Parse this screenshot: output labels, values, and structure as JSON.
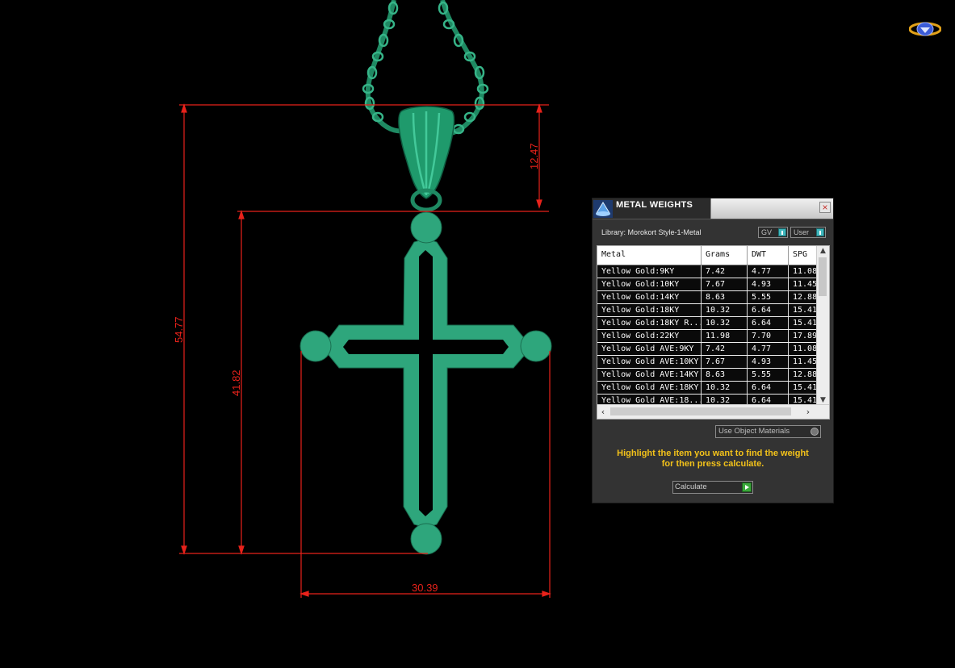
{
  "viewport": {
    "dimensions": {
      "overall_height": "54.77",
      "body_height": "41.82",
      "bail_height": "12.47",
      "width": "30.39"
    },
    "colors": {
      "model": "#2ea67c",
      "dimension_lines": "#e8221b",
      "background": "#000000"
    }
  },
  "panel": {
    "title": "METAL WEIGHTS",
    "close_label": "×",
    "library_label": "Library: Morokort Style-1-Metal",
    "gv_toggle": "GV",
    "user_toggle": "User",
    "columns": [
      "Metal",
      "Grams",
      "DWT",
      "SPG"
    ],
    "rows": [
      [
        "Yellow Gold:9KY",
        "7.42",
        "4.77",
        "11.08"
      ],
      [
        "Yellow Gold:10KY",
        "7.67",
        "4.93",
        "11.45"
      ],
      [
        "Yellow Gold:14KY",
        "8.63",
        "5.55",
        "12.88"
      ],
      [
        "Yellow Gold:18KY",
        "10.32",
        "6.64",
        "15.41"
      ],
      [
        "Yellow Gold:18KY R...",
        "10.32",
        "6.64",
        "15.41"
      ],
      [
        "Yellow Gold:22KY",
        "11.98",
        "7.70",
        "17.89"
      ],
      [
        "Yellow Gold AVE:9KY",
        "7.42",
        "4.77",
        "11.08"
      ],
      [
        "Yellow Gold AVE:10KY",
        "7.67",
        "4.93",
        "11.45"
      ],
      [
        "Yellow Gold AVE:14KY",
        "8.63",
        "5.55",
        "12.88"
      ],
      [
        "Yellow Gold AVE:18KY",
        "10.32",
        "6.64",
        "15.41"
      ],
      [
        "Yellow Gold AVE:18...",
        "10.32",
        "6.64",
        "15.41"
      ]
    ],
    "use_object_materials": "Use Object Materials",
    "hint_line1": "Highlight the item you want to find the weight",
    "hint_line2": "for then press calculate.",
    "calculate_label": "Calculate",
    "colors": {
      "panel_bg": "#333333",
      "hint": "#f3c21a",
      "toggle_accent": "#40b7bd",
      "calculate_accent": "#3aa83a"
    }
  }
}
